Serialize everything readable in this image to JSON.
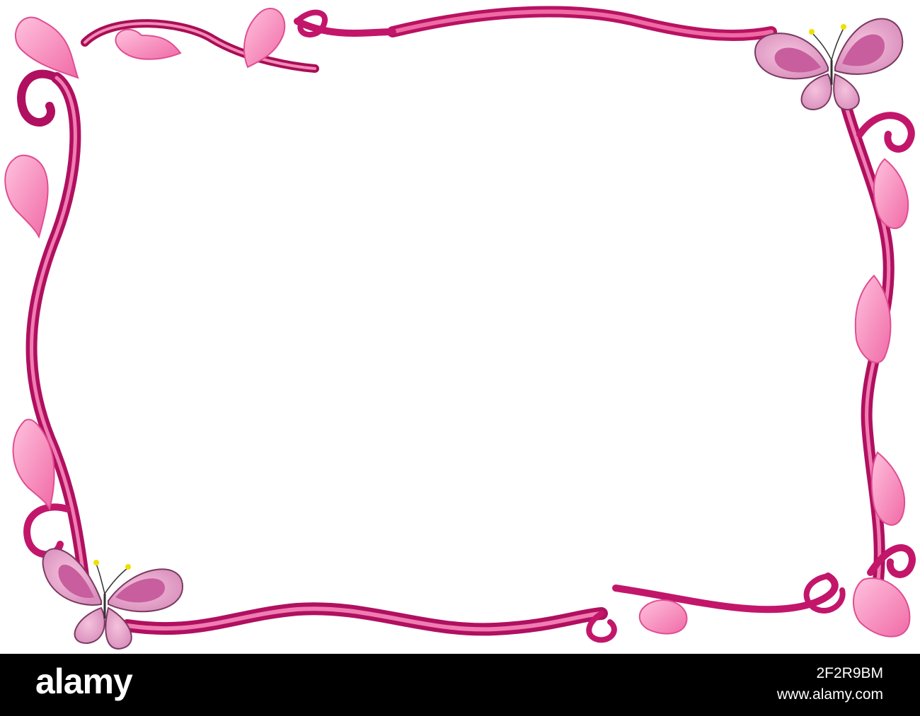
{
  "artwork": {
    "description_name": "pink-heart-butterfly-frame",
    "colors": {
      "frame_dark": "#b0105a",
      "frame_mid": "#e0307f",
      "frame_light": "#f59ac4",
      "heart_fill": "#f58cbc",
      "heart_highlight": "#ffd0e6",
      "wing_outer": "#e8a6cc",
      "wing_inner": "#c75a9c",
      "wing_core": "#e68ec0",
      "antenna_tip": "#f0e000"
    }
  },
  "footer": {
    "brand": "alamy",
    "image_id": "2F2R9BM",
    "url": "www.alamy.com",
    "background": "#000000",
    "text_color": "#ffffff"
  }
}
